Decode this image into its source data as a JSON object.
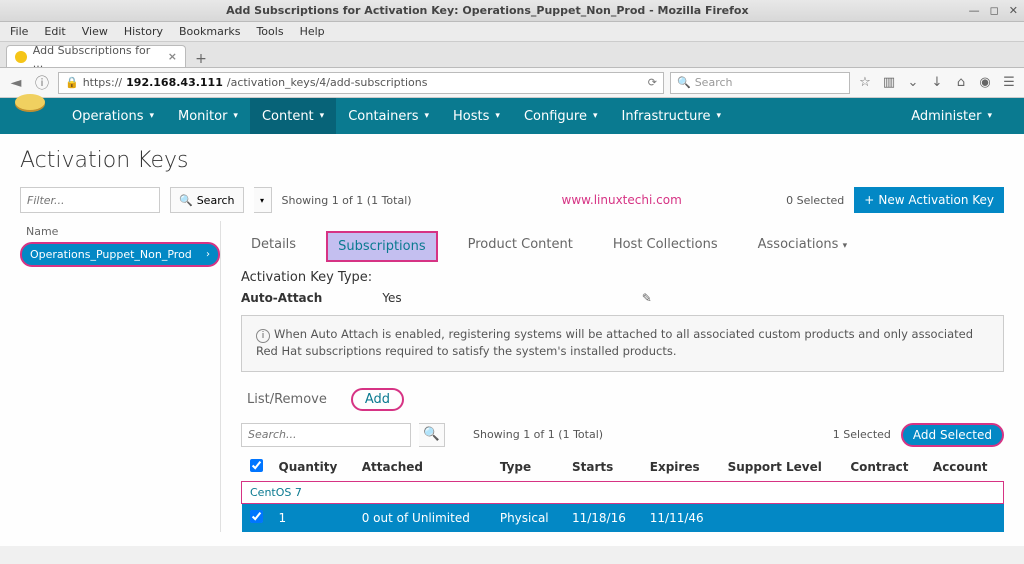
{
  "window": {
    "title": "Add Subscriptions for Activation Key: Operations_Puppet_Non_Prod - Mozilla Firefox"
  },
  "menubar": [
    "File",
    "Edit",
    "View",
    "History",
    "Bookmarks",
    "Tools",
    "Help"
  ],
  "tab": {
    "label": "Add Subscriptions for ..."
  },
  "url": {
    "scheme": "https://",
    "host": "192.168.43.111",
    "path": "/activation_keys/4/add-subscriptions"
  },
  "search": {
    "placeholder": "Search"
  },
  "appnav": {
    "items": [
      "Operations",
      "Monitor",
      "Content",
      "Containers",
      "Hosts",
      "Configure",
      "Infrastructure"
    ],
    "active": "Content",
    "right": "Administer"
  },
  "page": {
    "title": "Activation Keys",
    "filter_placeholder": "Filter...",
    "search_label": "Search",
    "showing": "Showing 1 of 1 (1 Total)",
    "watermark": "www.linuxtechi.com",
    "selected": "0 Selected",
    "new_btn": "New Activation Key"
  },
  "left": {
    "header": "Name",
    "item": "Operations_Puppet_Non_Prod"
  },
  "detail_tabs": [
    "Details",
    "Subscriptions",
    "Product Content",
    "Host Collections",
    "Associations"
  ],
  "detail_active": "Subscriptions",
  "type_label": "Activation Key Type:",
  "auto": {
    "label": "Auto-Attach",
    "value": "Yes"
  },
  "info": "When Auto Attach is enabled, registering systems will be attached to all associated custom products and only associated Red Hat subscriptions required to satisfy the system's installed products.",
  "subtabs": {
    "list": "List/Remove",
    "add": "Add"
  },
  "subtoolbar": {
    "search_placeholder": "Search...",
    "showing": "Showing 1 of 1 (1 Total)",
    "selected": "1 Selected",
    "add_btn": "Add Selected"
  },
  "table": {
    "headers": [
      "Quantity",
      "Attached",
      "Type",
      "Starts",
      "Expires",
      "Support Level",
      "Contract",
      "Account"
    ],
    "group": "CentOS 7",
    "row": {
      "quantity": "1",
      "attached": "0 out of Unlimited",
      "type": "Physical",
      "starts": "11/18/16",
      "expires": "11/11/46",
      "support": "",
      "contract": "",
      "account": ""
    }
  }
}
